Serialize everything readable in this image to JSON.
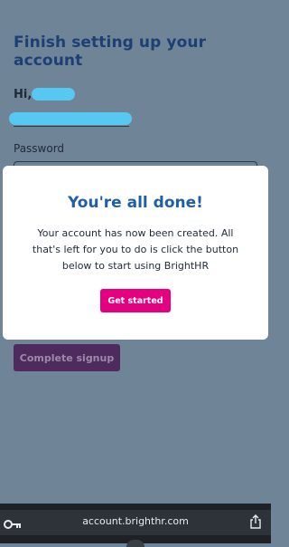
{
  "page": {
    "title": "Finish setting up your account",
    "greeting": "Hi,",
    "password_label": "Password",
    "complete_button": "Complete signup"
  },
  "modal": {
    "title": "You're all done!",
    "body": "Your account has now been created. All that's left for you to do is click the button below to start using BrightHR",
    "button": "Get started"
  },
  "browser": {
    "url": "account.brighthr.com",
    "icons": [
      "key-icon",
      "share-icon"
    ]
  },
  "colors": {
    "accent_pink": "#e4007f",
    "modal_title_blue": "#1f5fa8",
    "overlay": "#6f8496"
  }
}
